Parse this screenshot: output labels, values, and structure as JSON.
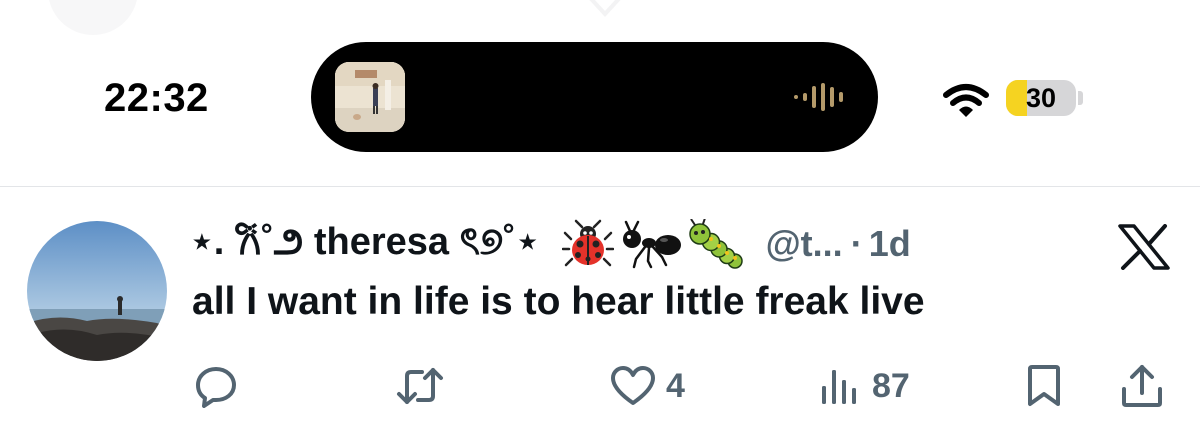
{
  "status_bar": {
    "time": "22:32",
    "battery_level": "30",
    "battery_fraction": 0.3,
    "wifi_icon": "wifi-icon",
    "audio_indicator_icon": "audio-waveform-icon"
  },
  "tweet": {
    "display_name": "⋆. 𐙚˚౨ theresa ৎ୭˚⋆",
    "name_emojis": [
      "ladybug-emoji",
      "ant-emoji",
      "caterpillar-emoji"
    ],
    "handle": "@t...",
    "separator": "·",
    "timestamp": "1d",
    "text": "all I want in life is to hear little freak live",
    "platform_logo": "x-logo-icon"
  },
  "actions": {
    "reply_icon": "reply-icon",
    "retweet_icon": "retweet-icon",
    "like_icon": "heart-icon",
    "like_count": "4",
    "views_icon": "views-icon",
    "views_count": "87",
    "bookmark_icon": "bookmark-icon",
    "share_icon": "share-icon"
  },
  "colors": {
    "text_primary": "#0f1419",
    "text_secondary": "#536471",
    "battery_yellow": "#f5d321"
  }
}
